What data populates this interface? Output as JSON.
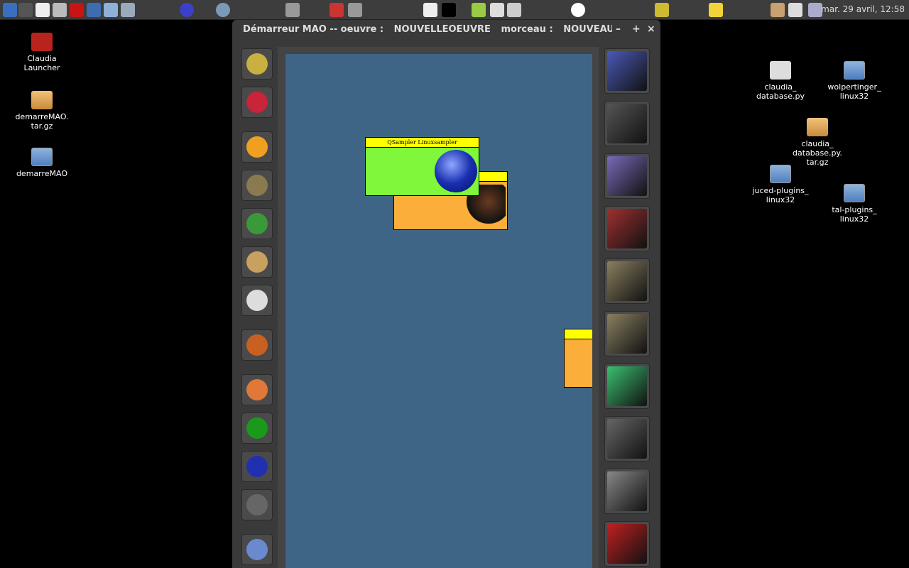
{
  "panel": {
    "launchers": [
      "fish-icon",
      "terminal-icon",
      "text-editor-icon",
      "disc-burner-icon",
      "filezilla-icon",
      "computer-icon",
      "file-manager-icon",
      "search-icon",
      "claws-mail-icon",
      "chromium-icon",
      "settings-icon",
      "ssr-icon",
      "screenshot-icon",
      "usb-icon",
      "cpu-monitor-icon",
      "trash-icon",
      "document-icon",
      "pen-icon",
      "a-icon",
      "pencil-icon",
      "note-icon",
      "clipboard-icon",
      "network-icon",
      "volume-icon"
    ],
    "clock": "mar. 29 avril, 12:58"
  },
  "desktop": {
    "items": [
      {
        "label": "Claudia Launcher",
        "icon": "claudia-launcher-icon"
      },
      {
        "label": "demarreMAO.\ntar.gz",
        "icon": "archive-icon"
      },
      {
        "label": "demarreMAO",
        "icon": "folder-icon"
      },
      {
        "label": "claudia_\ndatabase.py",
        "icon": "python-file-icon"
      },
      {
        "label": "wolpertinger_\nlinux32",
        "icon": "folder-icon"
      },
      {
        "label": "claudia_\ndatabase.py.\ntar.gz",
        "icon": "archive-icon"
      },
      {
        "label": "juced-plugins_\nlinux32",
        "icon": "folder-icon"
      },
      {
        "label": "tal-plugins_\nlinux32",
        "icon": "folder-icon"
      }
    ]
  },
  "window": {
    "title_app": "Démarreur MAO -- oeuvre :",
    "oeuvre": "NOUVELLEOEUVRE",
    "morceau_label": "morceau :",
    "morceau": "NOUVEAUMORCEAU",
    "minimize": "–",
    "maximize": "+",
    "close": "×",
    "left_tools": [
      "jack-cable-icon",
      "ardour-icon",
      "rosegarden-icon",
      "gramophone-icon",
      "lmms-icon",
      "harp-icon",
      "drum-icon",
      "knot-icon",
      "drop-icon",
      "oscilloscope-icon",
      "linuxsampler-icon",
      "tux-tool-icon",
      "keyboard-icon"
    ],
    "right_tools": [
      "tux-concert-icon",
      "tux-guitar-icon",
      "tux-cd-icon",
      "tux-bookshelf-icon",
      "tux-builder-icon",
      "tux-hammer-icon",
      "tux-cabinet-icon",
      "tux-trash-icon",
      "tux-truck-icon",
      "tux-toolbox-icon"
    ],
    "nodes": [
      {
        "label": "QSampler Linuxsampler",
        "color": "#80f73b"
      },
      {
        "label": "",
        "color": "#fbaf3a"
      },
      {
        "label": "",
        "color": "#fbaf3a"
      }
    ]
  }
}
